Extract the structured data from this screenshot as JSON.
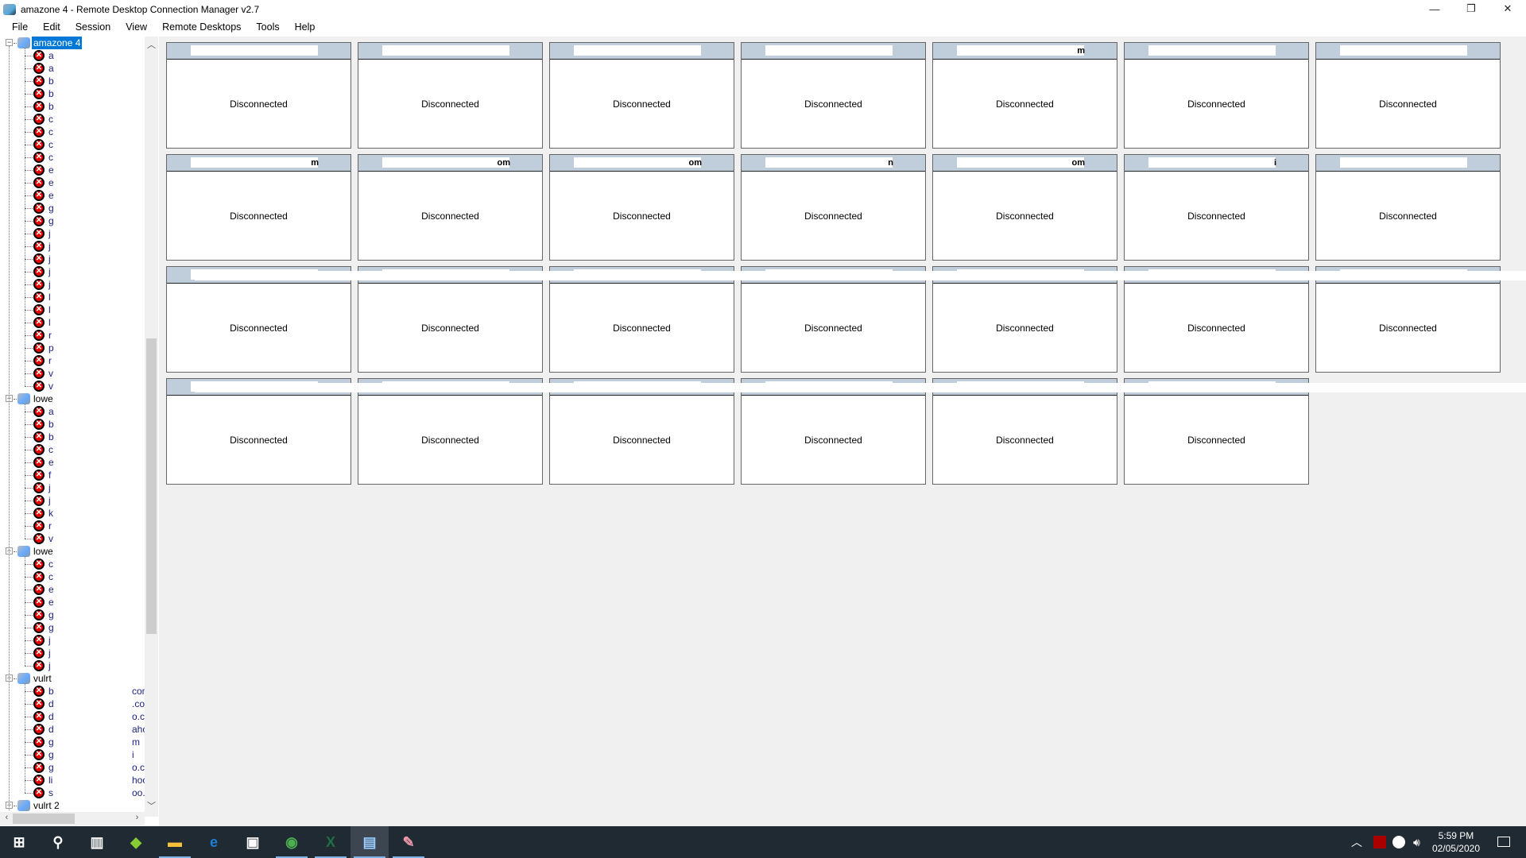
{
  "window": {
    "title": "amazone 4 - Remote Desktop Connection Manager v2.7",
    "controls": [
      "—",
      "❐",
      "✕"
    ]
  },
  "menu": [
    "File",
    "Edit",
    "Session",
    "View",
    "Remote Desktops",
    "Tools",
    "Help"
  ],
  "tree": {
    "groups": [
      {
        "label": "amazone 4",
        "selected": true,
        "items": [
          {
            "label": "a"
          },
          {
            "label": "a"
          },
          {
            "label": "b"
          },
          {
            "label": "b"
          },
          {
            "label": "b"
          },
          {
            "label": "c"
          },
          {
            "label": "c"
          },
          {
            "label": "c"
          },
          {
            "label": "c"
          },
          {
            "label": "e"
          },
          {
            "label": "e"
          },
          {
            "label": "e"
          },
          {
            "label": "g"
          },
          {
            "label": "g"
          },
          {
            "label": "j"
          },
          {
            "label": "j"
          },
          {
            "label": "j"
          },
          {
            "label": "j"
          },
          {
            "label": "j"
          },
          {
            "label": "l"
          },
          {
            "label": "l"
          },
          {
            "label": "l"
          },
          {
            "label": "r"
          },
          {
            "label": "p"
          },
          {
            "label": "r"
          },
          {
            "label": "v"
          },
          {
            "label": "v"
          }
        ]
      },
      {
        "label": "lowe",
        "items": [
          {
            "label": "a"
          },
          {
            "label": "b"
          },
          {
            "label": "b"
          },
          {
            "label": "c"
          },
          {
            "label": "e"
          },
          {
            "label": "f"
          },
          {
            "label": "j"
          },
          {
            "label": "j"
          },
          {
            "label": "k"
          },
          {
            "label": "r"
          },
          {
            "label": "v"
          }
        ]
      },
      {
        "label": "lowe",
        "items": [
          {
            "label": "c"
          },
          {
            "label": "c"
          },
          {
            "label": "e"
          },
          {
            "label": "e"
          },
          {
            "label": "g"
          },
          {
            "label": "g"
          },
          {
            "label": "j"
          },
          {
            "label": "j"
          },
          {
            "label": "j"
          }
        ]
      },
      {
        "label": "vulrt",
        "items": [
          {
            "label": "b",
            "frag": "com"
          },
          {
            "label": "d",
            "frag": ".co"
          },
          {
            "label": "d",
            "frag": "o.c"
          },
          {
            "label": "d",
            "frag": "ahc"
          },
          {
            "label": "g",
            "frag": "m"
          },
          {
            "label": "g",
            "frag": "i"
          },
          {
            "label": "g",
            "frag": "o.c"
          },
          {
            "label": "li",
            "frag": "hoo"
          },
          {
            "label": "s",
            "frag": "oo."
          }
        ]
      },
      {
        "label": "vulrt 2",
        "items": []
      }
    ]
  },
  "thumbnails": {
    "status": "Disconnected",
    "rows": [
      [
        "",
        "",
        "",
        "",
        "m",
        "",
        ""
      ],
      [
        "m",
        "om",
        "om",
        "n",
        "om",
        "i",
        ""
      ],
      [
        "",
        "",
        "",
        "",
        "",
        "",
        ""
      ],
      [
        "",
        "",
        "",
        "",
        "",
        ""
      ]
    ]
  },
  "taskbar": {
    "apps": [
      "start-icon",
      "search-icon",
      "task-view-icon",
      "bluestacks-icon",
      "file-explorer-icon",
      "edge-icon",
      "store-icon",
      "chrome-icon",
      "excel-icon",
      "rdcman-icon",
      "paint-icon"
    ],
    "active_app": "rdcman-icon",
    "time": "5:59 PM",
    "date": "02/05/2020"
  },
  "colors": {
    "tile_header": "#c0cddb",
    "selection": "#0078d7",
    "taskbar": "#202a32",
    "error": "#e00000"
  }
}
